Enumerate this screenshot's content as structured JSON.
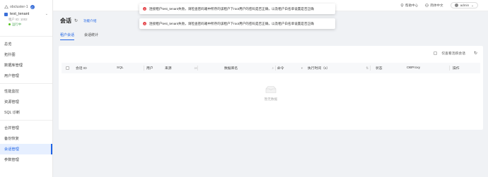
{
  "sidebar": {
    "cluster_name": "obcluster-1",
    "cluster_badge": "C",
    "tenant_name": "test_tenant",
    "tenant_id_label": "租户 ID: 1002",
    "tenant_status": "运行中",
    "items": [
      {
        "label": "总览"
      },
      {
        "label": "拓扑图"
      },
      {
        "label": "数据库管理"
      },
      {
        "label": "用户管理"
      },
      {
        "label": "性能监控"
      },
      {
        "label": "资源管理"
      },
      {
        "label": "SQL 诊断"
      },
      {
        "label": "合并管理"
      },
      {
        "label": "备份恢复"
      },
      {
        "label": "会话管理"
      },
      {
        "label": "参数管理"
      }
    ]
  },
  "topbar": {
    "help": "帮助中心",
    "language": "简体中文",
    "user": "admin"
  },
  "page": {
    "title": "会话",
    "function_intro": "功能介绍",
    "tabs": [
      "租户会话",
      "会话统计"
    ]
  },
  "toolbar": {
    "active_only": "仅查看活跃会话"
  },
  "table": {
    "columns": [
      "会话 ID",
      "SQL",
      "用户",
      "来源",
      "数据库名",
      "命令",
      "执行时间（s）",
      "状态",
      "OBProxy",
      "操作"
    ],
    "empty_text": "暂无数据"
  },
  "toasts": [
    {
      "text": "连接租户test_tenant失败，请检查密码箱中所存的该租户下root用户的密码是否正确，以及租户白名单设置是否正确"
    },
    {
      "text": "连接租户test_tenant失败，请检查密码箱中所存的该租户下root用户的密码是否正确，以及租户白名单设置是否正确"
    }
  ],
  "colors": {
    "accent": "#1f64e6",
    "error": "#e5484d",
    "success": "#52c41a"
  }
}
